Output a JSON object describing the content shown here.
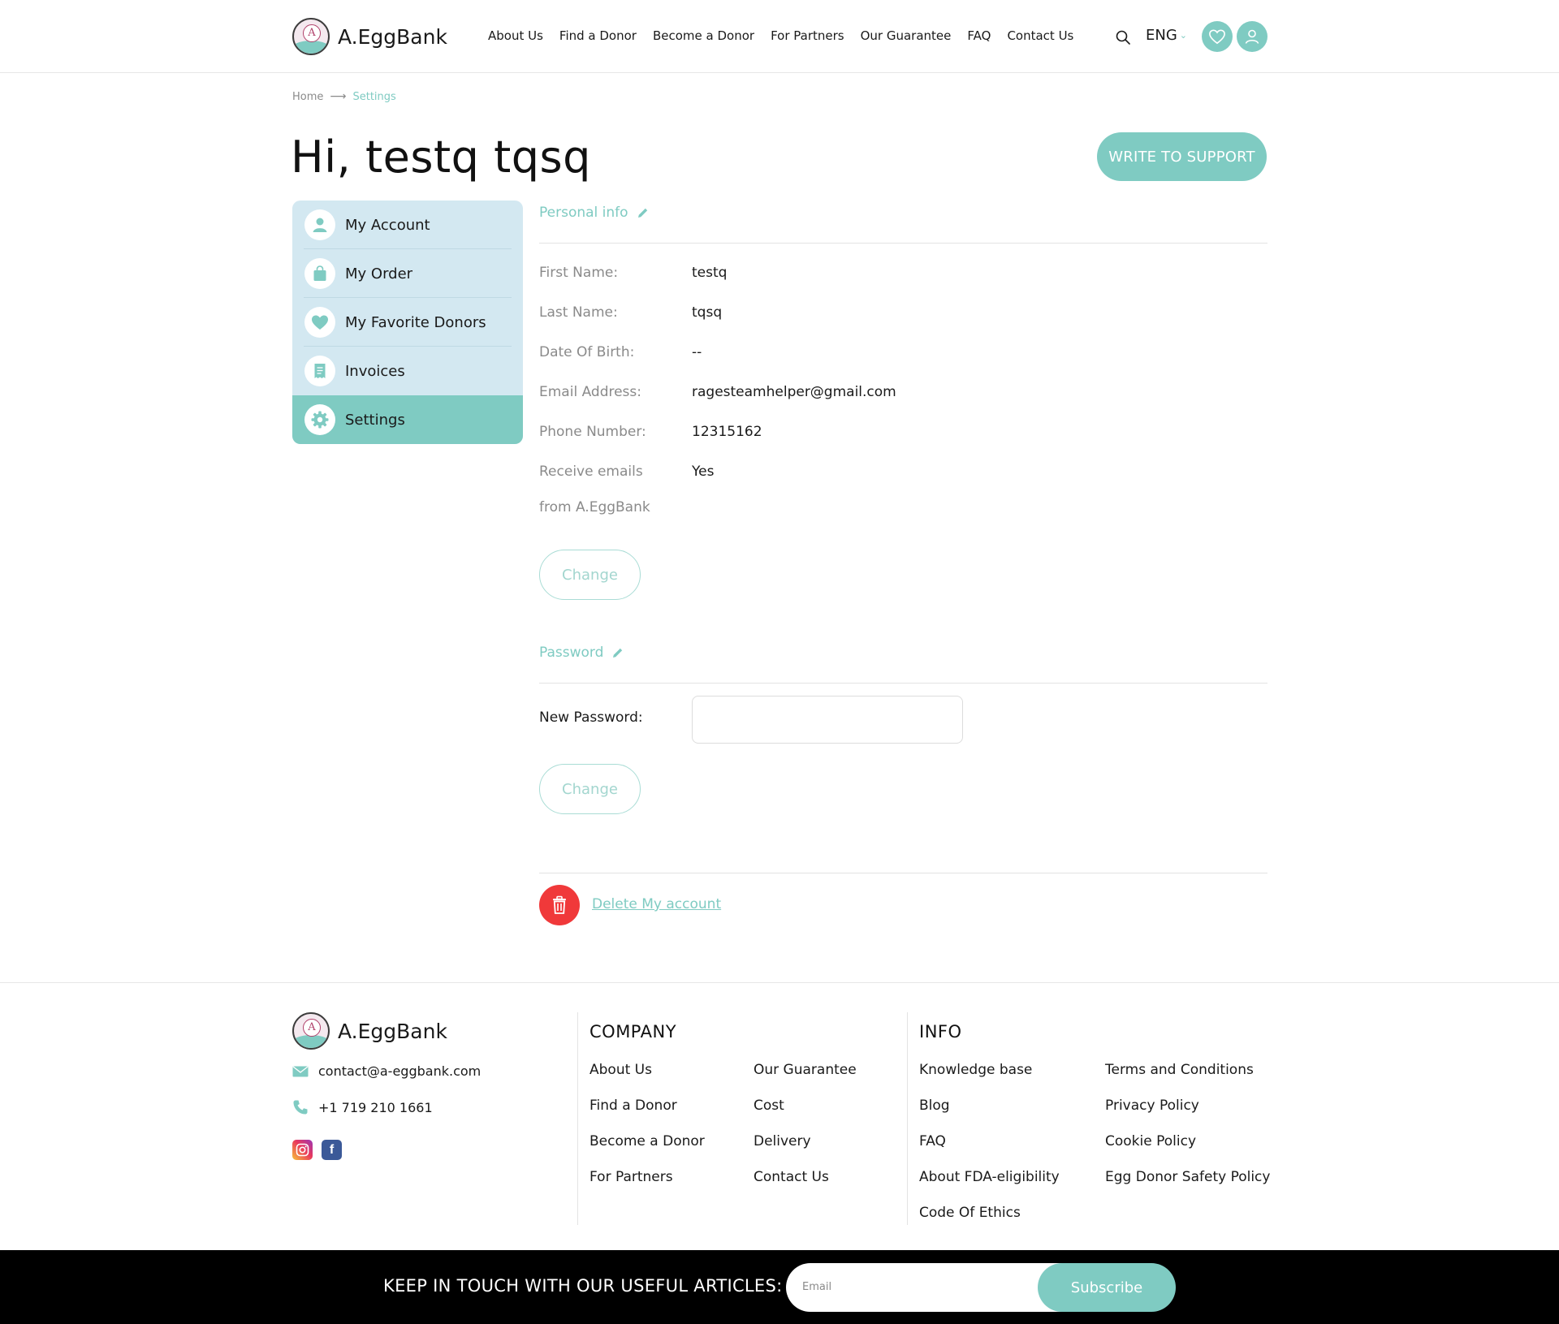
{
  "brand": {
    "name": "A.EggBank",
    "mark_letter": "A"
  },
  "colors": {
    "accent": "#7fcbc2",
    "sidebar_bg": "#d3e8f1",
    "danger": "#f0393a"
  },
  "nav": {
    "items": [
      "About Us",
      "Find a Donor",
      "Become a Donor",
      "For Partners",
      "Our Guarantee",
      "FAQ",
      "Contact Us"
    ],
    "language": "ENG"
  },
  "breadcrumb": {
    "home": "Home",
    "current": "Settings"
  },
  "page": {
    "greeting": "Hi, testq tqsq",
    "support_button": "WRITE TO SUPPORT"
  },
  "sidebar": {
    "items": [
      {
        "label": "My Account",
        "icon": "user-icon"
      },
      {
        "label": "My Order",
        "icon": "shopping-bag-icon"
      },
      {
        "label": "My Favorite Donors",
        "icon": "heart-icon"
      },
      {
        "label": "Invoices",
        "icon": "receipt-icon"
      },
      {
        "label": "Settings",
        "icon": "gear-icon",
        "active": true
      }
    ]
  },
  "personal_info": {
    "title": "Personal info",
    "fields": [
      {
        "label": "First Name:",
        "value": "testq"
      },
      {
        "label": "Last Name:",
        "value": "tqsq"
      },
      {
        "label": "Date Of Birth:",
        "value": "--"
      },
      {
        "label": "Email Address:",
        "value": "ragesteamhelper@gmail.com"
      },
      {
        "label": "Phone Number:",
        "value": "12315162"
      },
      {
        "label": "Receive emails",
        "value": "Yes"
      }
    ],
    "receive_emails_label_line2": "from A.EggBank",
    "change_button": "Change"
  },
  "password": {
    "title": "Password",
    "new_password_label": "New Password:",
    "new_password_value": "",
    "change_button": "Change"
  },
  "delete_account": {
    "label": "Delete My account"
  },
  "footer": {
    "brand": "A.EggBank",
    "email": "contact@a-eggbank.com",
    "phone": "+1 719 210 1661",
    "company": {
      "title": "COMPANY",
      "col1": [
        "About Us",
        "Find a Donor",
        "Become a Donor",
        "For Partners"
      ],
      "col2": [
        "Our Guarantee",
        "Cost",
        "Delivery",
        "Contact Us"
      ]
    },
    "info": {
      "title": "INFO",
      "col1": [
        "Knowledge base",
        "Blog",
        "FAQ",
        "About FDA-eligibility",
        "Code Of Ethics"
      ],
      "col2": [
        "Terms and Conditions",
        "Privacy Policy",
        "Cookie Policy",
        "Egg Donor Safety Policy"
      ]
    }
  },
  "newsletter": {
    "text": "KEEP IN TOUCH WITH OUR USEFUL ARTICLES:",
    "placeholder": "Email",
    "button": "Subscribe"
  }
}
